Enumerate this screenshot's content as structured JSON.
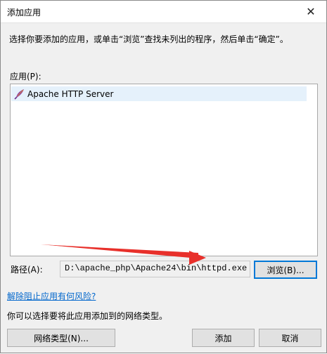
{
  "window": {
    "title": "添加应用",
    "close_glyph": "✕"
  },
  "instruction": "选择你要添加的应用，或单击“浏览”查找未列出的程序，然后单击“确定”。",
  "apps": {
    "label": "应用(P):",
    "items": [
      {
        "name": "Apache HTTP Server",
        "icon": "apache-feather-icon",
        "selected": true
      }
    ]
  },
  "path": {
    "label": "路径(A):",
    "value": "D:\\apache_php\\Apache24\\bin\\httpd.exe"
  },
  "buttons": {
    "browse": "浏览(B)...",
    "network_types": "网络类型(N)...",
    "add": "添加",
    "cancel": "取消"
  },
  "risk_link": "解除阻止应用有何风险?",
  "network_text": "你可以选择要将此应用添加到的网络类型。",
  "colors": {
    "link": "#0066cc",
    "selection": "#e5f1fb",
    "focus_border": "#0078d7",
    "arrow": "#e8302b"
  }
}
